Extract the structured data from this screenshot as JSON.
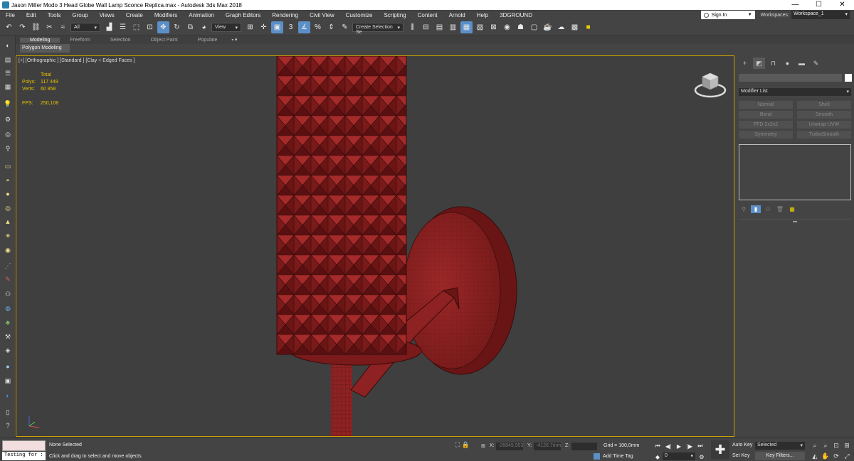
{
  "window": {
    "title": "Jason Miller Modo 3 Head Globe Wall Lamp Sconce Replica.max - Autodesk 3ds Max 2018",
    "minimize": "—",
    "maximize": "☐",
    "close": "✕"
  },
  "menu": {
    "items": [
      "File",
      "Edit",
      "Tools",
      "Group",
      "Views",
      "Create",
      "Modifiers",
      "Animation",
      "Graph Editors",
      "Rendering",
      "Civil View",
      "Customize",
      "Scripting",
      "Content",
      "Arnold",
      "Help",
      "3DGROUND"
    ],
    "sign_in": "Sign In",
    "workspaces_label": "Workspaces:",
    "workspace_value": "Workspace_1"
  },
  "toolbar": {
    "filter_value": "All",
    "ref_coord_value": "View",
    "selection_set_value": "Create Selection Se",
    "snap_label": "3",
    "percent_snap_label": "%"
  },
  "ribbon": {
    "tabs": [
      "Modeling",
      "Freeform",
      "Selection",
      "Object Paint",
      "Populate"
    ],
    "extra": "▪ ▾",
    "panel_label": "Polygon Modeling"
  },
  "viewport": {
    "label": "[+] [Orthographic ] [Standard ] [Clay + Edged Faces ]",
    "stats_header": "Total",
    "polys_label": "Polys:",
    "polys_value": "117 448",
    "verts_label": "Verts:",
    "verts_value": "60 858",
    "fps_label": "FPS:",
    "fps_value": "250,106",
    "model_color": "#8e2222",
    "model_edge_color": "#3a0b0b"
  },
  "command_panel": {
    "modifier_list": "Modifier List",
    "modifiers": [
      "Normal",
      "Shell",
      "Bend",
      "Smooth",
      "FFD 2x2x2",
      "Unwrap UVW",
      "Symmetry",
      "TurboSmooth"
    ]
  },
  "status": {
    "script_text": "Testing for :",
    "selection": "None Selected",
    "prompt": "Click and drag to select and move objects",
    "x_label": "X:",
    "x_value": "-26849,953",
    "y_label": "Y:",
    "y_value": "-4126,7mm",
    "z_label": "Z:",
    "z_value": "",
    "grid": "Grid = 100,0mm",
    "add_time_tag": "Add Time Tag",
    "frame_value": "0",
    "auto_key": "Auto Key",
    "set_key": "Set Key",
    "key_mode_value": "Selected",
    "key_filters": "Key Filters..."
  },
  "colors": {
    "viewport_border": "#c8a000",
    "active_blue": "#5b8fc7",
    "stats_yellow": "#e6c200"
  }
}
